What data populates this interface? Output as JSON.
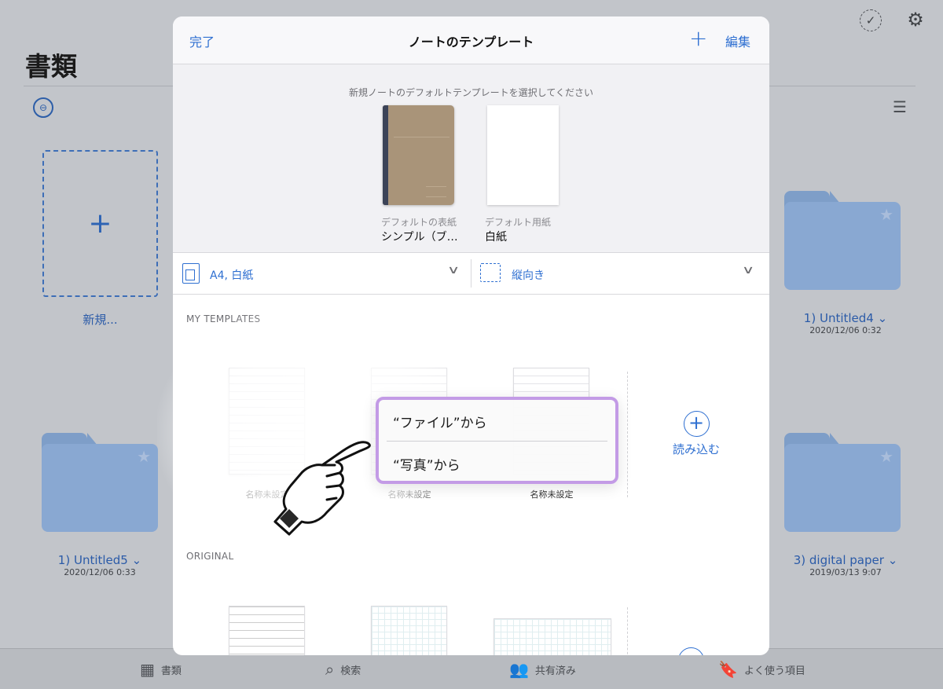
{
  "background": {
    "page_title": "書類",
    "new_label": "新規...",
    "folders": [
      {
        "name": "1) Untitled4",
        "chevron": "⌄",
        "date": "2020/12/06 0:32"
      },
      {
        "name": "1) Untitled5",
        "chevron": "⌄",
        "date": "2020/12/06 0:33"
      },
      {
        "name": "3) digital paper",
        "chevron": "⌄",
        "date": "2019/03/13 9:07"
      }
    ],
    "tabbar": [
      "書類",
      "検索",
      "共有済み",
      "よく使う項目"
    ]
  },
  "modal": {
    "done": "完了",
    "title": "ノートのテンプレート",
    "plus": "+",
    "edit": "編集",
    "prompt": "新規ノートのデフォルトテンプレートを選択してください",
    "default_cover": {
      "caption": "デフォルトの表紙",
      "value": "シンプル（ブ…"
    },
    "default_paper": {
      "caption": "デフォルト用紙",
      "value": "白紙"
    },
    "size_selector": "A4, 白紙",
    "orientation_selector": "縦向き",
    "my_templates_header": "MY TEMPLATES",
    "original_header": "ORIGINAL",
    "my_templates": [
      {
        "name": "名称未設定"
      },
      {
        "name": "名称未設定"
      },
      {
        "name": "名称未設定"
      }
    ],
    "import_label": "読み込む",
    "popover": {
      "from_files": "“ファイル”から",
      "from_photos": "“写真”から"
    }
  },
  "colors": {
    "accent": "#2e6fd1",
    "popover_border": "#c39be6",
    "cover": "#a99479"
  },
  "icons": [
    "select-icon",
    "gear-icon",
    "sort-icon",
    "list-icon",
    "grid-icon",
    "search-icon",
    "people-icon",
    "bookmark-icon",
    "plus-icon",
    "chevron-down-icon",
    "pointing-hand-icon"
  ]
}
